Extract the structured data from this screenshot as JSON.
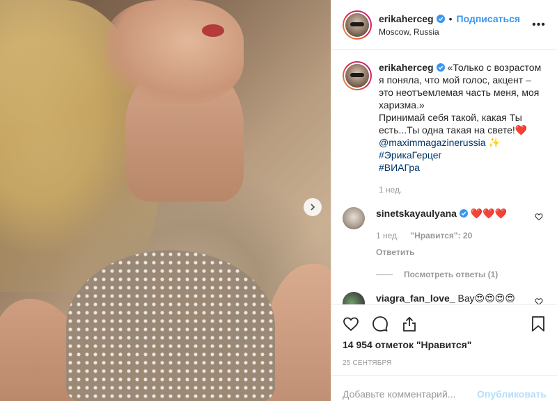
{
  "post": {
    "username": "erikaherceg",
    "follow_label": "Подписаться",
    "dot": "•",
    "location": "Moscow, Russia",
    "more_label": "•••"
  },
  "caption": {
    "username": "erikaherceg",
    "line1": "«Только с возрастом я поняла, что мой голос, акцент – это неотъемлемая часть меня, моя харизма.»",
    "line2": "Принимай себя такой, какая Ты есть...Ты одна такая на свете!❤️",
    "mention": "@maximmagazinerussia",
    "sparkle": "✨",
    "tag1": "#ЭрикаГерцег",
    "tag2": "#ВИАГра",
    "time": "1 нед."
  },
  "comments": [
    {
      "username": "sinetskayaulyana",
      "text": "❤️❤️❤️",
      "time": "1 нед.",
      "likes": "\"Нравится\": 20",
      "reply": "Ответить",
      "view_replies": "Посмотреть ответы (1)"
    },
    {
      "username": "viagra_fan_love_",
      "text": "Вау😍😍😍😍"
    }
  ],
  "likes_text": "14 954 отметок \"Нравится\"",
  "date": "25 СЕНТЯБРЯ",
  "add_comment": {
    "placeholder": "Добавьте комментарий...",
    "publish_label": "Опубликовать"
  },
  "colors": {
    "accent": "#3897f0",
    "publish_disabled": "#b2dffc",
    "muted": "#999999",
    "text": "#262626"
  }
}
